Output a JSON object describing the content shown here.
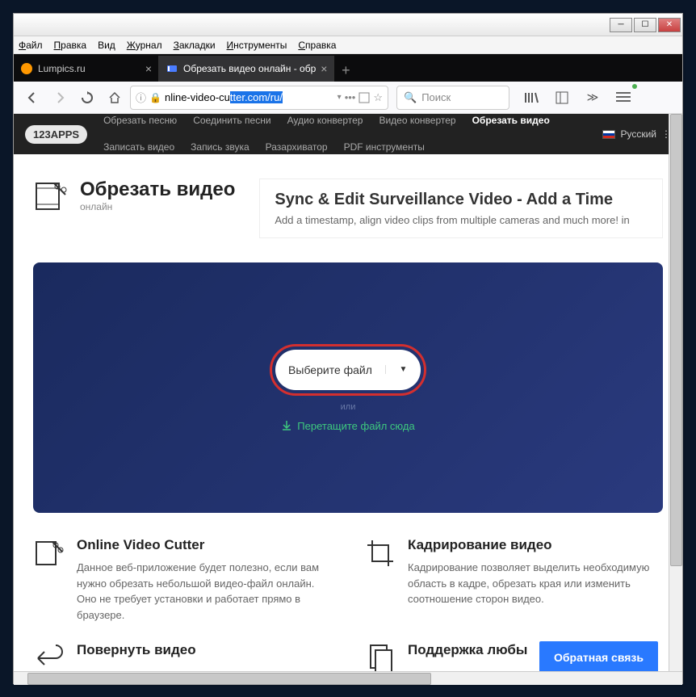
{
  "menu": {
    "file": "Файл",
    "edit": "Правка",
    "view": "Вид",
    "history": "Журнал",
    "bookmarks": "Закладки",
    "tools": "Инструменты",
    "help": "Справка"
  },
  "tabs": [
    {
      "label": "Lumpics.ru"
    },
    {
      "label": "Обрезать видео онлайн - обр"
    }
  ],
  "url": {
    "prefix": "nline-video-cu",
    "selected": "tter.com/ru/"
  },
  "search": {
    "placeholder": "Поиск"
  },
  "header": {
    "logo": "123APPS",
    "links": [
      "Обрезать песню",
      "Соединить песни",
      "Аудио конвертер",
      "Видео конвертер",
      "Обрезать видео",
      "Записать видео",
      "Запись звука",
      "Разархиватор",
      "PDF инструменты"
    ],
    "activeIndex": 4,
    "lang": "Русский"
  },
  "title": {
    "heading": "Обрезать видео",
    "sub": "онлайн"
  },
  "ad": {
    "heading": "Sync & Edit Surveillance Video - Add a Time",
    "text": "Add a timestamp, align video clips from multiple cameras and much more! in"
  },
  "upload": {
    "button": "Выберите файл",
    "or": "или",
    "drag": "Перетащите файл сюда"
  },
  "features": [
    {
      "title": "Online Video Cutter",
      "text": "Данное веб-приложение будет полезно, если вам нужно обрезать небольшой видео-файл онлайн. Оно не требует установки и работает прямо в браузере."
    },
    {
      "title": "Кадрирование видео",
      "text": "Кадрирование позволяет выделить необходимую область в кадре, обрезать края или изменить соотношение сторон видео."
    },
    {
      "title": "Повернуть видео",
      "text": ""
    },
    {
      "title": "Поддержка любы",
      "text": ""
    }
  ],
  "feedback": "Обратная связь"
}
